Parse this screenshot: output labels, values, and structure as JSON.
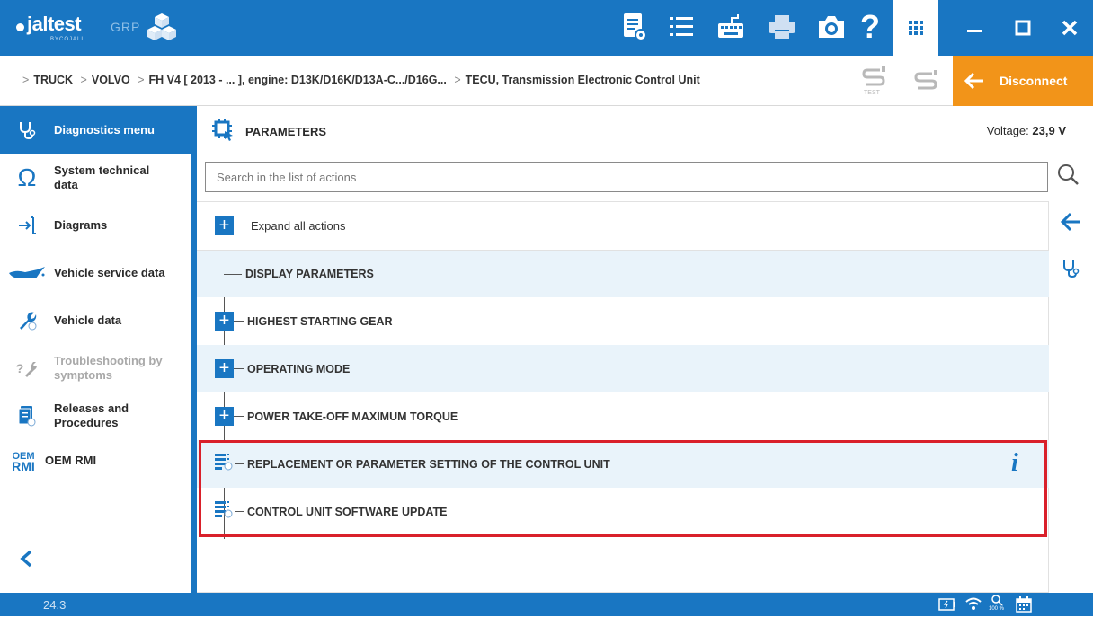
{
  "app": {
    "logo": "jaltest",
    "logo_sub": "BYCOJALI",
    "product": "GRP"
  },
  "toolbar": {
    "icons": [
      "report-icon",
      "list-icon",
      "keyboard-icon",
      "printer-icon",
      "camera-icon",
      "help-icon",
      "apps-grid-icon"
    ],
    "help_glyph": "?"
  },
  "window": {
    "minimize": "—",
    "maximize": "☐",
    "close": "✕"
  },
  "breadcrumb": {
    "items": [
      "TRUCK",
      "VOLVO",
      "FH V4 [ 2013 - ... ], engine: D13K/D16K/D13A-C.../D16G...",
      "TECU, Transmission Electronic Control Unit"
    ],
    "separator": ">"
  },
  "test_label": "TEST",
  "disconnect_label": "Disconnect",
  "sidebar": {
    "items": [
      {
        "label": "Diagnostics menu",
        "icon": "stethoscope-icon"
      },
      {
        "label": "System technical data",
        "icon": "omega-icon"
      },
      {
        "label": "Diagrams",
        "icon": "diagram-icon"
      },
      {
        "label": "Vehicle service data",
        "icon": "oil-can-icon"
      },
      {
        "label": "Vehicle data",
        "icon": "wrench-icon"
      },
      {
        "label": "Troubleshooting by symptoms",
        "icon": "troubleshoot-icon"
      },
      {
        "label": "Releases and Procedures",
        "icon": "documents-icon"
      },
      {
        "label": "OEM RMI",
        "icon": "oem-rmi-icon"
      }
    ],
    "oem_text_1": "OEM",
    "oem_text_2": "RMI",
    "collapse_glyph": "‹"
  },
  "main": {
    "title": "PARAMETERS",
    "voltage_label": "Voltage:",
    "voltage_value": "23,9 V",
    "search_placeholder": "Search in the list of actions",
    "expand_all": "Expand all actions",
    "rows": [
      {
        "label": "DISPLAY PARAMETERS"
      },
      {
        "label": "HIGHEST STARTING GEAR"
      },
      {
        "label": "OPERATING MODE"
      },
      {
        "label": "POWER TAKE-OFF MAXIMUM TORQUE"
      },
      {
        "label": "REPLACEMENT OR PARAMETER SETTING OF THE CONTROL UNIT"
      },
      {
        "label": "CONTROL UNIT SOFTWARE UPDATE"
      }
    ],
    "plus_glyph": "+",
    "info_glyph": "i"
  },
  "status": {
    "version": "24.3",
    "zoom": "100 %"
  },
  "colors": {
    "primary": "#1976c2",
    "accent": "#f29419",
    "highlight": "#d9202a",
    "row_alt": "#e9f3fa"
  }
}
